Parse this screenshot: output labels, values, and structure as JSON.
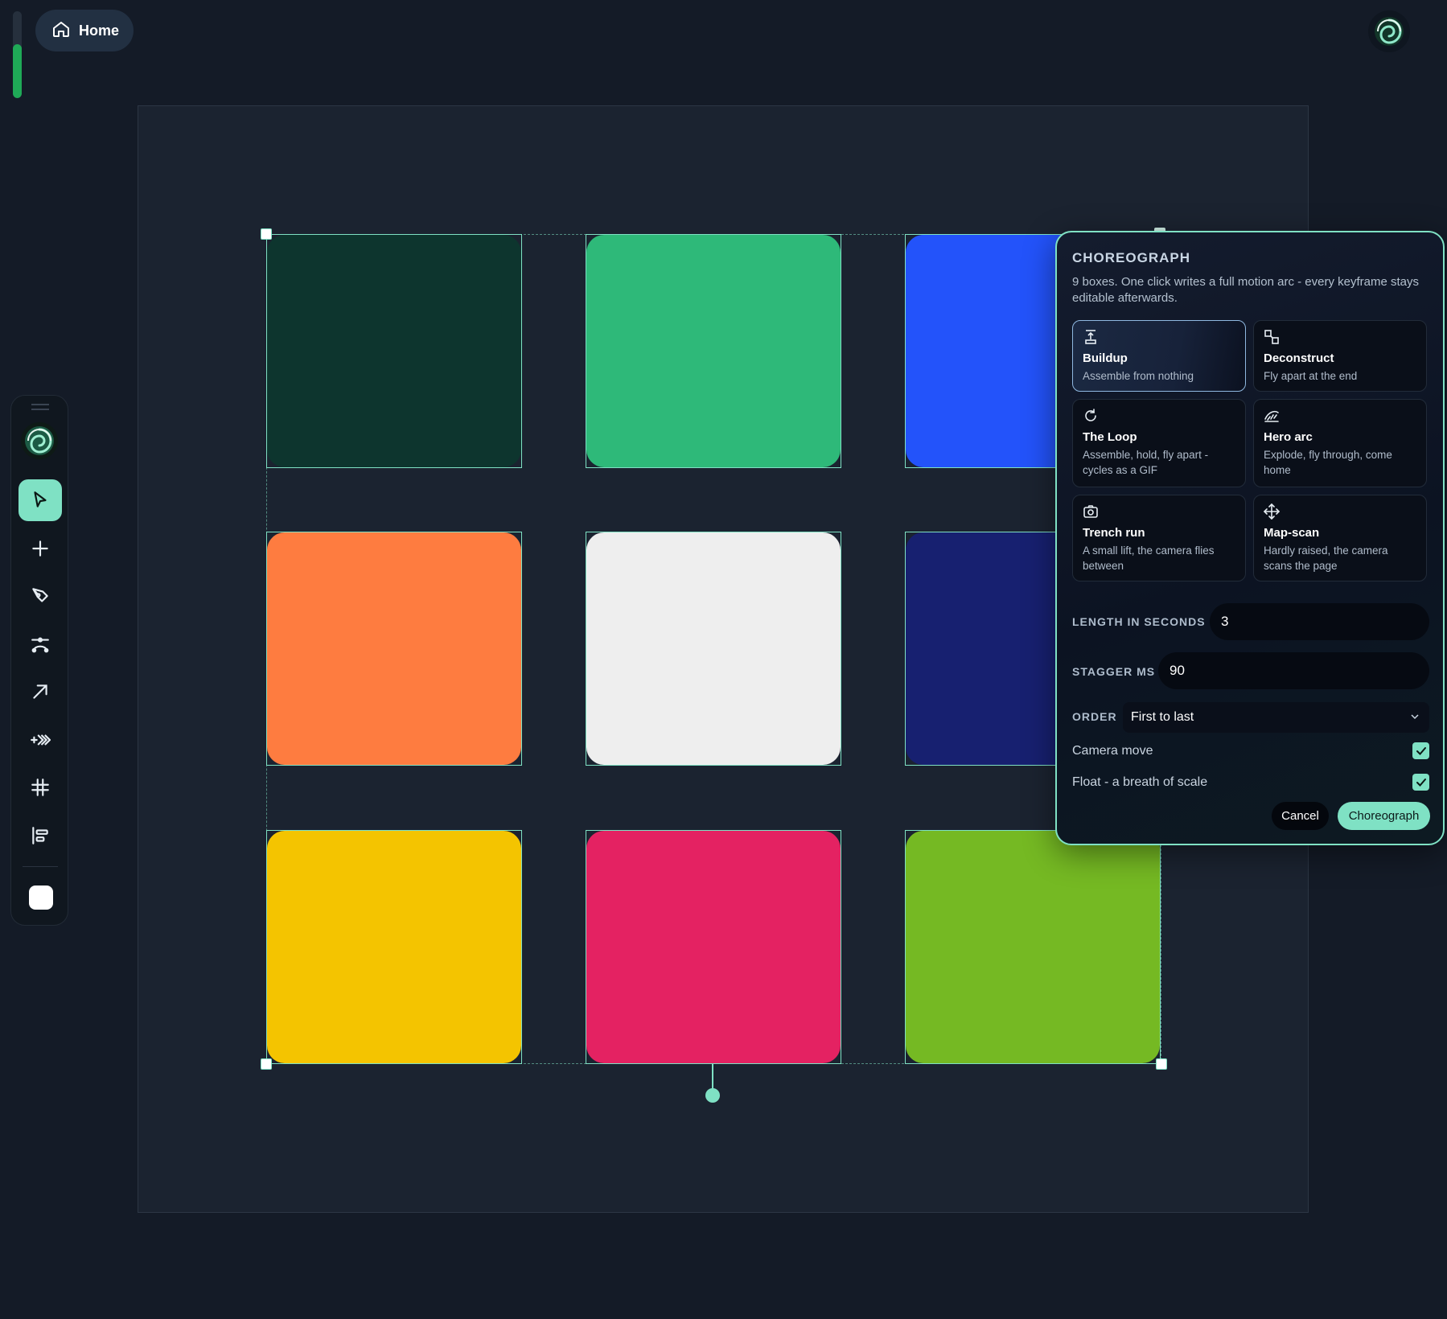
{
  "progress": {
    "fill_percent": 62,
    "color": "#1faa57"
  },
  "home": {
    "label": "Home"
  },
  "toolbar": {
    "tools": [
      "pointer",
      "add",
      "pen",
      "bezier",
      "arrow",
      "fast-forward",
      "grid",
      "align"
    ],
    "active_tool": "pointer",
    "active_color": "#7fe1c4",
    "swatch_color": "#ffffff"
  },
  "canvas": {
    "boxes": [
      {
        "color": "#0d352e"
      },
      {
        "color": "#2eb979"
      },
      {
        "color": "#2353fa"
      },
      {
        "color": "#fe7c40"
      },
      {
        "color": "#eeeeee"
      },
      {
        "color": "#172070"
      },
      {
        "color": "#f4c400"
      },
      {
        "color": "#e42262"
      },
      {
        "color": "#75b923"
      }
    ],
    "selection_color": "#7fe1c4"
  },
  "panel": {
    "title": "CHOREOGRAPH",
    "description": "9 boxes. One click writes a full motion arc - every keyframe stays editable afterwards.",
    "presets": [
      {
        "icon": "buildup-icon",
        "title": "Buildup",
        "subtitle": "Assemble from nothing",
        "active": true
      },
      {
        "icon": "deconstruct-icon",
        "title": "Deconstruct",
        "subtitle": "Fly apart at the end",
        "active": false
      },
      {
        "icon": "loop-icon",
        "title": "The Loop",
        "subtitle": "Assemble, hold, fly apart - cycles as a GIF",
        "active": false
      },
      {
        "icon": "hero-arc-icon",
        "title": "Hero arc",
        "subtitle": "Explode, fly through, come home",
        "active": false
      },
      {
        "icon": "camera-icon",
        "title": "Trench run",
        "subtitle": "A small lift, the camera flies between",
        "active": false
      },
      {
        "icon": "move-icon",
        "title": "Map-scan",
        "subtitle": "Hardly raised, the camera scans the page",
        "active": false
      }
    ],
    "length_label": "LENGTH IN SECONDS",
    "length_value": "3",
    "stagger_label": "STAGGER MS",
    "stagger_value": "90",
    "order_label": "ORDER",
    "order_value": "First to last",
    "camera_label": "Camera move",
    "camera_checked": true,
    "float_label": "Float - a breath of scale",
    "float_checked": true,
    "cancel_label": "Cancel",
    "submit_label": "Choreograph"
  }
}
